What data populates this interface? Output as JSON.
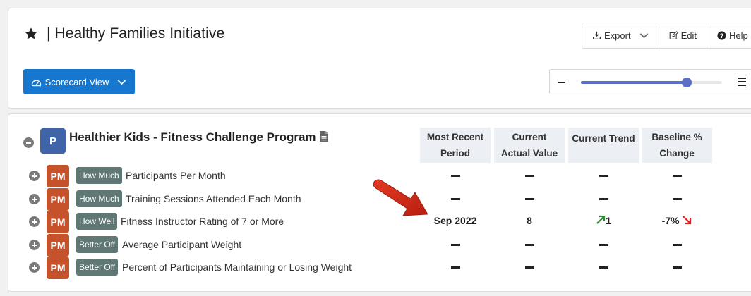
{
  "header": {
    "title": "| Healthy Families Initiative",
    "export_label": "Export",
    "edit_label": "Edit",
    "help_label": "Help",
    "view_label": "Scorecard View",
    "zoom_level": 0.75
  },
  "program": {
    "badge": "P",
    "title": "Healthier Kids - Fitness Challenge Program"
  },
  "columns": [
    {
      "line1": "Most Recent",
      "line2": "Period"
    },
    {
      "line1": "Current",
      "line2": "Actual Value"
    },
    {
      "line1": "Current Trend",
      "line2": ""
    },
    {
      "line1": "Baseline %",
      "line2": "Change"
    }
  ],
  "measures": [
    {
      "badge": "PM",
      "category": "How Much",
      "name": "Participants Per Month",
      "period": "",
      "actual": "",
      "trend": "",
      "baseline": ""
    },
    {
      "badge": "PM",
      "category": "How Much",
      "name": "Training Sessions Attended Each Month",
      "period": "",
      "actual": "",
      "trend": "",
      "baseline": ""
    },
    {
      "badge": "PM",
      "category": "How Well",
      "name": "Fitness Instructor Rating of 7 or More",
      "period": "Sep 2022",
      "actual": "8",
      "trend": "1",
      "baseline": "-7%"
    },
    {
      "badge": "PM",
      "category": "Better Off",
      "name": "Average Participant Weight",
      "period": "",
      "actual": "",
      "trend": "",
      "baseline": ""
    },
    {
      "badge": "PM",
      "category": "Better Off",
      "name": "Percent of Participants Maintaining or Losing Weight",
      "period": "",
      "actual": "",
      "trend": "",
      "baseline": ""
    }
  ],
  "colors": {
    "primary": "#1776cd",
    "program_badge": "#3f64a8",
    "pm_badge": "#c5522b",
    "category_badge": "#5f7775",
    "trend_up": "#2e8b2e",
    "trend_down": "#e02020",
    "callout_arrow": "#d42a1a"
  }
}
